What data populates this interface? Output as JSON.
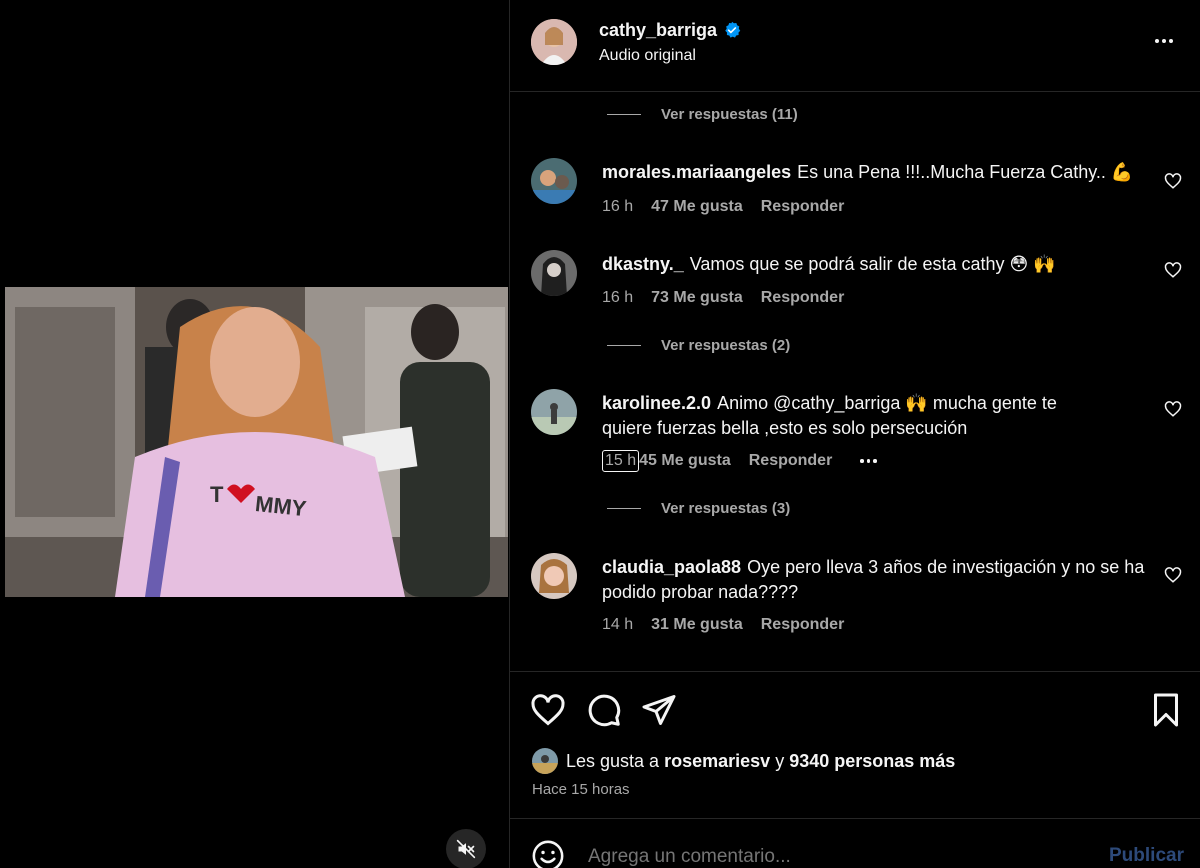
{
  "header": {
    "username": "cathy_barriga",
    "subtitle": "Audio original"
  },
  "replies": [
    {
      "label": "Ver respuestas (11)"
    },
    {
      "label": "Ver respuestas (2)"
    },
    {
      "label": "Ver respuestas (3)"
    }
  ],
  "comments": [
    {
      "username": "morales.mariaangeles",
      "text": "Es una Pena !!!..Mucha Fuerza Cathy.. 💪",
      "time": "16 h",
      "likes": "47 Me gusta",
      "reply": "Responder"
    },
    {
      "username": "dkastny._",
      "text": "Vamos que se podrá salir de esta cathy 😳 🙌",
      "time": "16 h",
      "likes": "73 Me gusta",
      "reply": "Responder"
    },
    {
      "username": "karolinee.2.0",
      "text": "Animo @cathy_barriga 🙌  mucha gente te quiere fuerzas bella ,esto es solo persecución",
      "time": "15 h",
      "likes": "45 Me gusta",
      "reply": "Responder"
    },
    {
      "username": "claudia_paola88",
      "text": "Oye pero lleva 3 años de investigación y no se ha podido probar nada????",
      "time": "14 h",
      "likes": "31 Me gusta",
      "reply": "Responder"
    }
  ],
  "likes": {
    "prefix": "Les gusta a",
    "user": "rosemariesv",
    "joiner": "y",
    "others": "9340 personas más"
  },
  "time_ago": "Hace 15 horas",
  "compose": {
    "placeholder": "Agrega un comentario...",
    "publish_label": "Publicar"
  },
  "colors": {
    "background": "#000000",
    "divider": "#262626",
    "muted_text": "#a8a8a8",
    "verified": "#0095f6",
    "publish_disabled": "#2d4a7a"
  }
}
